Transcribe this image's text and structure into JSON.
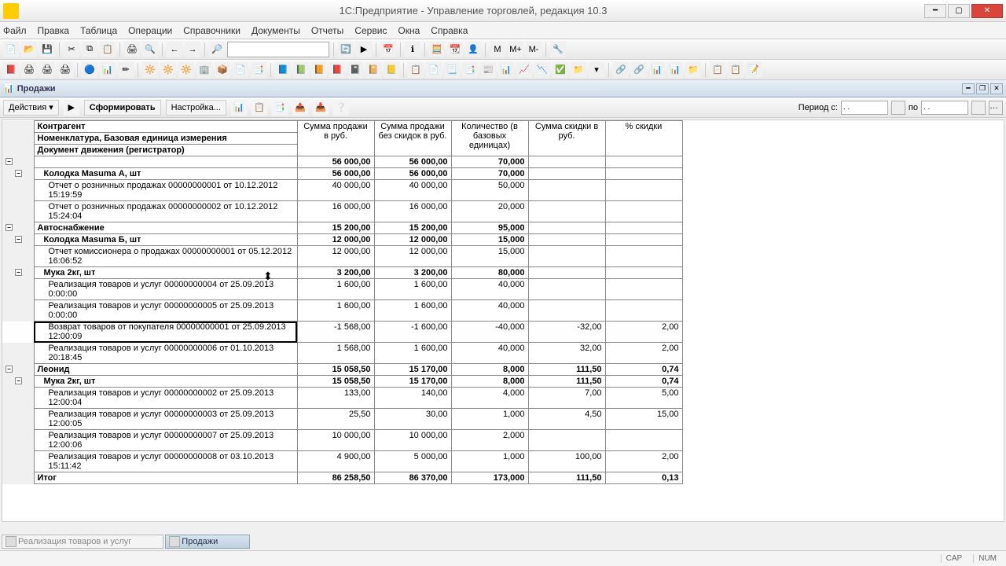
{
  "window": {
    "title": "1С:Предприятие - Управление торговлей, редакция 10.3"
  },
  "menu": [
    "Файл",
    "Правка",
    "Таблица",
    "Операции",
    "Справочники",
    "Документы",
    "Отчеты",
    "Сервис",
    "Окна",
    "Справка"
  ],
  "tab": {
    "title": "Продажи"
  },
  "actionbar": {
    "actions": "Действия ▾",
    "form": "Сформировать",
    "settings": "Настройка...",
    "period_label": "Период с:",
    "to": "по",
    "date_from": ". .",
    "date_to": ". ."
  },
  "headers": {
    "h1": "Контрагент",
    "h2": "Номенклатура, Базовая единица измерения",
    "h3": "Документ движения (регистратор)",
    "c1": "Сумма продажи в руб.",
    "c2": "Сумма продажи без скидок в руб.",
    "c3": "Количество (в базовых единицах)",
    "c4": "Сумма скидки в руб.",
    "c5": "% скидки"
  },
  "rows": [
    {
      "lvl": 0,
      "bold": true,
      "label": "",
      "c1": "56 000,00",
      "c2": "56 000,00",
      "c3": "70,000",
      "c4": "",
      "c5": ""
    },
    {
      "lvl": 1,
      "bold": true,
      "label": "Колодка Masuma А, шт",
      "c1": "56 000,00",
      "c2": "56 000,00",
      "c3": "70,000",
      "c4": "",
      "c5": ""
    },
    {
      "lvl": 2,
      "label": "Отчет о розничных продажах 00000000001 от 10.12.2012 15:19:59",
      "c1": "40 000,00",
      "c2": "40 000,00",
      "c3": "50,000",
      "c4": "",
      "c5": ""
    },
    {
      "lvl": 2,
      "label": "Отчет о розничных продажах 00000000002 от 10.12.2012 15:24:04",
      "c1": "16 000,00",
      "c2": "16 000,00",
      "c3": "20,000",
      "c4": "",
      "c5": ""
    },
    {
      "lvl": 0,
      "bold": true,
      "label": "Автоснабжение",
      "c1": "15 200,00",
      "c2": "15 200,00",
      "c3": "95,000",
      "c4": "",
      "c5": ""
    },
    {
      "lvl": 1,
      "bold": true,
      "label": "Колодка Masuma Б, шт",
      "c1": "12 000,00",
      "c2": "12 000,00",
      "c3": "15,000",
      "c4": "",
      "c5": ""
    },
    {
      "lvl": 2,
      "label": "Отчет комиссионера о продажах 00000000001 от 05.12.2012 16:06:52",
      "c1": "12 000,00",
      "c2": "12 000,00",
      "c3": "15,000",
      "c4": "",
      "c5": ""
    },
    {
      "lvl": 1,
      "bold": true,
      "label": "Мука 2кг, шт",
      "c1": "3 200,00",
      "c2": "3 200,00",
      "c3": "80,000",
      "c4": "",
      "c5": ""
    },
    {
      "lvl": 2,
      "label": "Реализация товаров и услуг 00000000004 от 25.09.2013 0:00:00",
      "c1": "1 600,00",
      "c2": "1 600,00",
      "c3": "40,000",
      "c4": "",
      "c5": ""
    },
    {
      "lvl": 2,
      "label": "Реализация товаров и услуг 00000000005 от 25.09.2013 0:00:00",
      "c1": "1 600,00",
      "c2": "1 600,00",
      "c3": "40,000",
      "c4": "",
      "c5": ""
    },
    {
      "lvl": 2,
      "sel": true,
      "label": "Возврат товаров от покупателя 00000000001 от 25.09.2013 12:00:09",
      "c1": "-1 568,00",
      "c2": "-1 600,00",
      "c3": "-40,000",
      "c4": "-32,00",
      "c5": "2,00"
    },
    {
      "lvl": 2,
      "label": "Реализация товаров и услуг 00000000006 от 01.10.2013 20:18:45",
      "c1": "1 568,00",
      "c2": "1 600,00",
      "c3": "40,000",
      "c4": "32,00",
      "c5": "2,00"
    },
    {
      "lvl": 0,
      "bold": true,
      "label": "Леонид",
      "c1": "15 058,50",
      "c2": "15 170,00",
      "c3": "8,000",
      "c4": "111,50",
      "c5": "0,74"
    },
    {
      "lvl": 1,
      "bold": true,
      "label": "Мука 2кг, шт",
      "c1": "15 058,50",
      "c2": "15 170,00",
      "c3": "8,000",
      "c4": "111,50",
      "c5": "0,74"
    },
    {
      "lvl": 2,
      "label": "Реализация товаров и услуг 00000000002 от 25.09.2013 12:00:04",
      "c1": "133,00",
      "c2": "140,00",
      "c3": "4,000",
      "c4": "7,00",
      "c5": "5,00"
    },
    {
      "lvl": 2,
      "label": "Реализация товаров и услуг 00000000003 от 25.09.2013 12:00:05",
      "c1": "25,50",
      "c2": "30,00",
      "c3": "1,000",
      "c4": "4,50",
      "c5": "15,00"
    },
    {
      "lvl": 2,
      "label": "Реализация товаров и услуг 00000000007 от 25.09.2013 12:00:06",
      "c1": "10 000,00",
      "c2": "10 000,00",
      "c3": "2,000",
      "c4": "",
      "c5": ""
    },
    {
      "lvl": 2,
      "label": "Реализация товаров и услуг 00000000008 от 03.10.2013 15:11:42",
      "c1": "4 900,00",
      "c2": "5 000,00",
      "c3": "1,000",
      "c4": "100,00",
      "c5": "2,00"
    },
    {
      "lvl": 0,
      "bold": true,
      "label": "Итог",
      "c1": "86 258,50",
      "c2": "86 370,00",
      "c3": "173,000",
      "c4": "111,50",
      "c5": "0,13"
    }
  ],
  "bottom_tabs": [
    {
      "label": "Реализация товаров и услуг",
      "active": false
    },
    {
      "label": "Продажи",
      "active": true
    }
  ],
  "status": {
    "cap": "CAP",
    "num": "NUM"
  }
}
